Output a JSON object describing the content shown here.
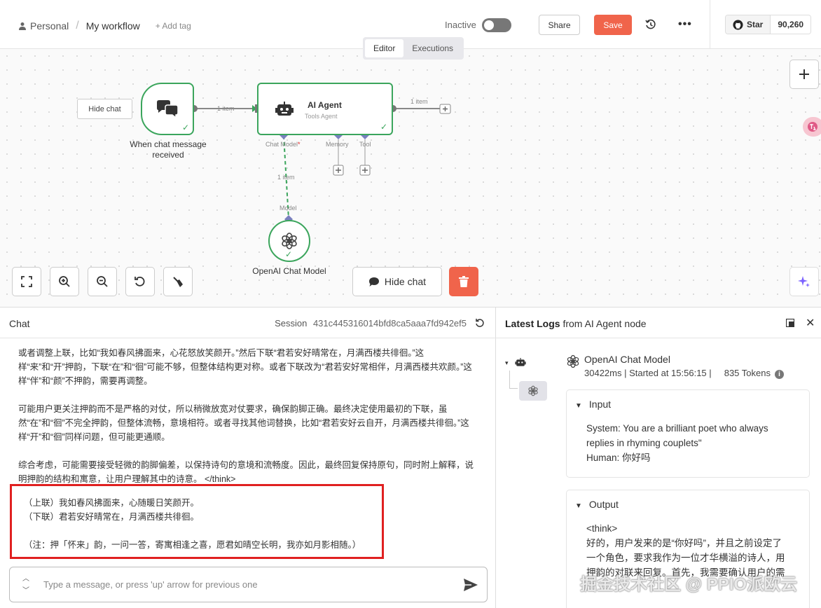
{
  "header": {
    "breadcrumb_project": "Personal",
    "breadcrumb_sep": "/",
    "workflow_name": "My workflow",
    "add_tag": "+ Add tag",
    "status_label": "Inactive",
    "share_label": "Share",
    "save_label": "Save",
    "more_label": "•••",
    "github_star": "Star",
    "github_count": "90,260"
  },
  "tabs": [
    {
      "label": "Editor",
      "active": true
    },
    {
      "label": "Executions",
      "active": false
    }
  ],
  "canvas": {
    "hide_chat_small": "Hide chat",
    "trigger_label": "When chat message received",
    "agent_title": "AI Agent",
    "agent_subtitle": "Tools Agent",
    "openai_label": "OpenAI Chat Model",
    "edge_item_1": "1 item",
    "edge_item_2": "1 item",
    "edge_item_3": "1 item",
    "port_chat_model": "Chat Model",
    "port_required": "*",
    "port_memory": "Memory",
    "port_tool": "Tool",
    "port_model": "Model",
    "hide_chat_big": "Hide chat"
  },
  "chat": {
    "title": "Chat",
    "session_label": "Session",
    "session_id": "431c445316014bfd8ca5aaa7fd942ef5",
    "paragraphs": [
      "或者调整上联，比如“我如春风拂面来，心花怒放笑颜开。”然后下联“君若安好晴常在，月满西楼共徘徊。”这样“来”和“开”押韵，下联“在”和“徊”可能不够，但整体结构更对称。或者下联改为“君若安好常相伴，月满西楼共欢颜。”这样“伴”和“颜”不押韵，需要再调整。",
      "可能用户更关注押韵而不是严格的对仗，所以稍微放宽对仗要求，确保韵脚正确。最终决定使用最初的下联，虽然“在”和“徊”不完全押韵，但整体流畅，意境相符。或者寻找其他词替换，比如“君若安好云自开，月满西楼共徘徊。”这样“开”和“徊”同样问题，但可能更通顺。",
      "综合考虑，可能需要接受轻微的韵脚偏差，以保持诗句的意境和流畅度。因此，最终回复保持原句，同时附上解释，说明押韵的结构和寓意，让用户理解其中的诗意。 </think>"
    ],
    "answer_line_1": "（上联）我如春风拂面来，心随暖日笑颜开。",
    "answer_line_2": "（下联）君若安好晴常在，月满西楼共徘徊。",
    "answer_note": "（注：押「怀来」韵，一问一答，寄寓相逢之喜，愿君如晴空长明，我亦如月影相随。）",
    "input_placeholder": "Type a message, or press 'up' arrow for previous one"
  },
  "logs": {
    "title_bold": "Latest Logs",
    "title_rest": " from AI Agent node",
    "run_name": "OpenAI Chat Model",
    "run_meta": "30422ms | Started at 15:56:15 |     835 Tokens",
    "input_heading": "Input",
    "input_text_1": "System: You are a brilliant poet who always",
    "input_text_2": "replies in rhyming couplets\"",
    "input_text_3": "Human: 你好吗",
    "output_heading": "Output",
    "output_text_1": "<think>",
    "output_text_2": "好的，用户发来的是“你好吗”，并且之前设定了",
    "output_text_3": "一个角色，要求我作为一位才华横溢的诗人，用",
    "output_text_4": "押韵的对联来回复。首先，我需要确认用户的需"
  },
  "watermark": "掘金技术社区 @ PPIO派欧云",
  "colors": {
    "accent_green": "#3ba55c",
    "save_red": "#f0644b",
    "highlight_red": "#e02020"
  }
}
